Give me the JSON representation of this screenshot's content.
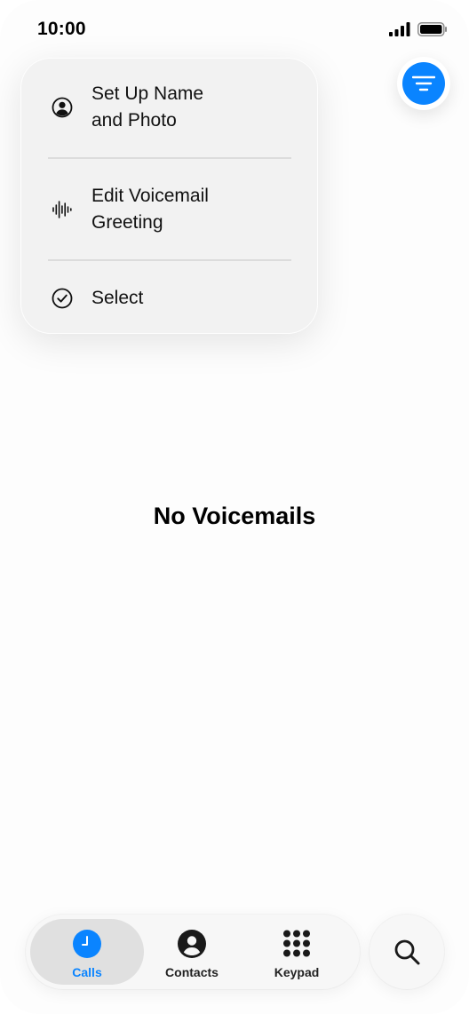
{
  "status_bar": {
    "time": "10:00",
    "icons": [
      "cellular-signal-icon",
      "battery-icon"
    ]
  },
  "filter_button": {
    "icon": "filter-lines-icon",
    "accent_color": "#0a84ff"
  },
  "menu": {
    "items": [
      {
        "label": "Set Up Name\nand Photo",
        "icon": "person-circle-icon"
      },
      {
        "label": "Edit Voicemail\nGreeting",
        "icon": "waveform-icon"
      },
      {
        "label": "Select",
        "icon": "checkmark-circle-icon"
      }
    ]
  },
  "empty_state": {
    "title": "No Voicemails"
  },
  "tab_bar": {
    "tabs": [
      {
        "label": "Calls",
        "icon": "clock-icon",
        "selected": true
      },
      {
        "label": "Contacts",
        "icon": "person-circle-fill-icon",
        "selected": false
      },
      {
        "label": "Keypad",
        "icon": "keypad-grid-icon",
        "selected": false
      }
    ]
  },
  "search_button": {
    "icon": "magnifying-glass-icon"
  }
}
